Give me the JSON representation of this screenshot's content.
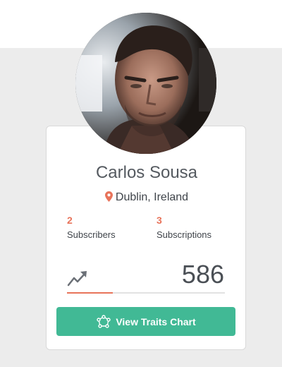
{
  "profile": {
    "name": "Carlos Sousa",
    "location": "Dublin, Ireland",
    "avatar_icon": "profile-photo"
  },
  "stats": [
    {
      "value": "2",
      "label": "Subscribers"
    },
    {
      "value": "3",
      "label": "Subscriptions"
    }
  ],
  "score": {
    "value": "586",
    "progress_fraction": 0.29,
    "icon": "trending-up-icon"
  },
  "action": {
    "label": "View Traits Chart",
    "icon": "network-graph-icon"
  },
  "colors": {
    "accent": "#e8735a",
    "button": "#41b995",
    "background": "#ececec"
  }
}
